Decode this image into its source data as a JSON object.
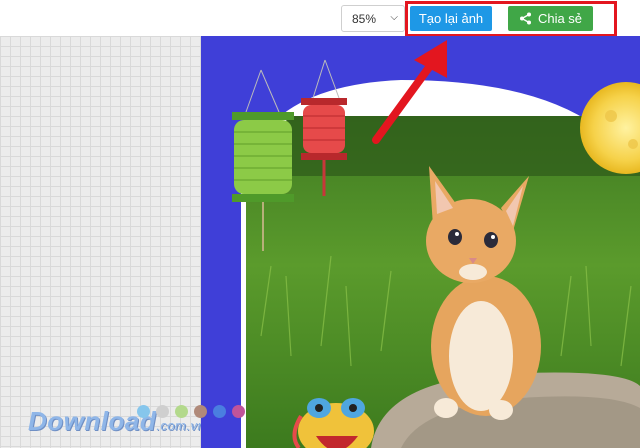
{
  "toolbar": {
    "zoom_value": "85%",
    "regenerate_label": "Tạo lại ảnh",
    "share_label": "Chia sẻ"
  },
  "watermark": {
    "brand": "Download",
    "tld": ".com.vn"
  },
  "colors": {
    "regenerate_button": "#1e98e6",
    "share_button": "#40a747",
    "highlight_border": "#e3161f",
    "card_background": "#3f3fd8"
  },
  "icons": [
    "caret-down-icon",
    "share-icon",
    "red-arrow-annotation"
  ],
  "dots": [
    "#86c6ec",
    "#cfcfcf",
    "#b3d98c",
    "#b08a7a",
    "#4a7ee0",
    "#c0549a"
  ]
}
